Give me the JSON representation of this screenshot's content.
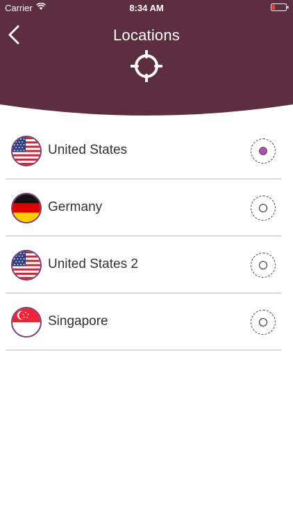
{
  "status_bar": {
    "carrier": "Carrier",
    "time": "8:34 AM",
    "icons": [
      "wifi-icon",
      "battery-icon"
    ]
  },
  "header": {
    "title": "Locations",
    "back_icon": "chevron-left-icon",
    "locate_icon": "crosshair-icon",
    "background_color": "#5c2e3f"
  },
  "accent_color": "#b04fb0",
  "locations": [
    {
      "label": "United States",
      "flag": "us-flag-icon",
      "selected": true
    },
    {
      "label": "Germany",
      "flag": "de-flag-icon",
      "selected": false
    },
    {
      "label": "United States 2",
      "flag": "us-flag-icon",
      "selected": false
    },
    {
      "label": "Singapore",
      "flag": "sg-flag-icon",
      "selected": false
    }
  ]
}
